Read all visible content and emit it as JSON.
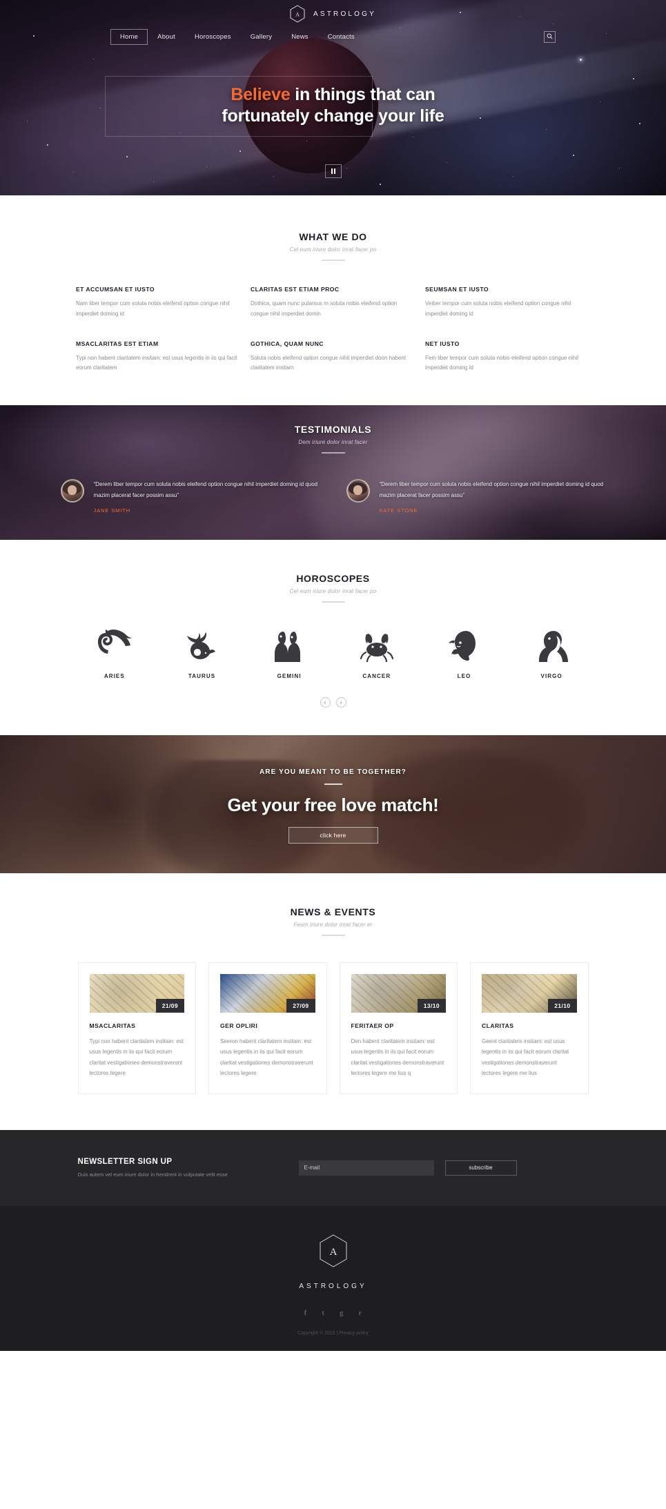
{
  "brand": {
    "name": "ASTROLOGY",
    "monogram": "A"
  },
  "nav": {
    "items": [
      {
        "label": "Home",
        "active": true
      },
      {
        "label": "About",
        "active": false
      },
      {
        "label": "Horoscopes",
        "active": false
      },
      {
        "label": "Gallery",
        "active": false
      },
      {
        "label": "News",
        "active": false
      },
      {
        "label": "Contacts",
        "active": false
      }
    ],
    "search_icon": "search-icon"
  },
  "hero": {
    "headline_accent": "Believe",
    "headline_rest": " in things that can",
    "headline_line2": "fortunately change your life",
    "pause_icon": "pause-icon"
  },
  "what_we_do": {
    "title": "WHAT WE DO",
    "subtitle": "Cel eum iriure dolor inrat facer po",
    "services": [
      {
        "title": "ET ACCUMSAN ET IUSTO",
        "text": "Nam liber tempor cum soluta nobis eleifend option congue nihil imperdiet doming id"
      },
      {
        "title": "CLARITAS EST ETIAM PROC",
        "text": "Dothica, quam nunc putamus m soluta nobis eleifend option congue nihil imperdiet domin"
      },
      {
        "title": "SEUMSAN ET IUSTO",
        "text": "Veiber tempor cum soluta nobis eleifend option congue nihil imperdiet doming id"
      },
      {
        "title": "MSACLARITAS EST ETIAM",
        "text": "Typi non habent claritatem insitam: est usus legentis in iis qui facit eorum claritatem"
      },
      {
        "title": "GOTHICA, QUAM NUNC",
        "text": "Soluta nobis eleifend option congue nihil imperdiet doon habent claritatem insitam"
      },
      {
        "title": "NET IUSTO",
        "text": "Fem liber tempor cum soluta nobis eleifend option congue nihil imperdiet doming id"
      }
    ]
  },
  "testimonials": {
    "title": "TESTIMONIALS",
    "subtitle": "Dem iriure dolor inrat facer",
    "items": [
      {
        "quote": "“Derem liber tempor cum soluta nobis eleifend option congue nihil imperdiet doming id quod mazim placerat facer possim assu”",
        "name": "JANE SMITH"
      },
      {
        "quote": "“Derem liber tempor cum soluta nobis eleifend option congue nihil imperdiet doming id quod mazim placerat facer possim assu”",
        "name": "KATE STONE"
      }
    ]
  },
  "horoscopes": {
    "title": "HOROSCOPES",
    "subtitle": "Cel eum iriure dolor inrat facer po",
    "signs": [
      {
        "label": "ARIES",
        "icon": "aries-ram-icon"
      },
      {
        "label": "TAURUS",
        "icon": "taurus-bull-icon"
      },
      {
        "label": "GEMINI",
        "icon": "gemini-twins-icon"
      },
      {
        "label": "CANCER",
        "icon": "cancer-crab-icon"
      },
      {
        "label": "LEO",
        "icon": "leo-lion-icon"
      },
      {
        "label": "VIRGO",
        "icon": "virgo-maiden-icon"
      }
    ],
    "prev_label": "‹",
    "next_label": "›"
  },
  "love_cta": {
    "kicker": "ARE YOU MEANT TO BE TOGETHER?",
    "title": "Get your free love match!",
    "button": "click here"
  },
  "news": {
    "title": "NEWS & EVENTS",
    "subtitle": "Feum iriure dolor inrat facer er",
    "cards": [
      {
        "date": "21/09",
        "title": "MSACLARITAS",
        "text": "Typi non habent claritatem insitam: est usus legentis in iis qui facit eorum claritat vestigationes demonstraverunt lectores legere"
      },
      {
        "date": "27/09",
        "title": "GER OPLIRI",
        "text": "Seeron habent claritatem insitam: est usus legentis in iis qui facit eorum claritat vestigationes demonstraverunt lectores legere"
      },
      {
        "date": "13/10",
        "title": "FERITAER OP",
        "text": "Den habent claritatem insitam: est usus legentis in iis qui facit eorum claritat vestigationes demonstraverunt lectores legere me lius q"
      },
      {
        "date": "21/10",
        "title": "CLARITAS",
        "text": "Geent claritatem insitam: est usus legentis in iis qui facit eorum claritat vestigationes demonstraverunt lectores legere me lius"
      }
    ]
  },
  "newsletter": {
    "title": "NEWSLETTER SIGN UP",
    "subtitle": "Duis autem vel eum iriure dolor in hendrerit in vulputate velit esse",
    "email_placeholder": "E-mail",
    "email_value": "",
    "submit_label": "subscribe"
  },
  "footer": {
    "brand": "ASTROLOGY",
    "monogram": "A",
    "social": [
      {
        "icon": "facebook-icon",
        "glyph": "f"
      },
      {
        "icon": "twitter-icon",
        "glyph": "t"
      },
      {
        "icon": "google-plus-icon",
        "glyph": "g"
      },
      {
        "icon": "rss-icon",
        "glyph": "r"
      }
    ],
    "copyright": "Copyright © 2015 |",
    "privacy_label": "Privacy policy"
  },
  "colors": {
    "accent": "#f26b33",
    "dark": "#1e1e20",
    "text": "#20202a",
    "muted": "#8d8d92"
  }
}
